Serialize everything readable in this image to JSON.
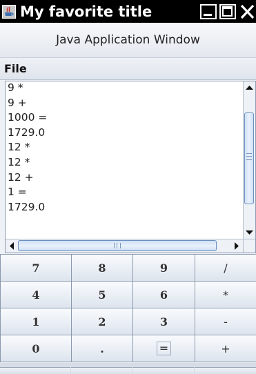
{
  "window": {
    "title": "My favorite title"
  },
  "header": {
    "label": "Java Application Window"
  },
  "menubar": {
    "items": [
      {
        "label": "File"
      }
    ]
  },
  "output": {
    "lines": [
      "9 *",
      "9 +",
      "1000 =",
      "1729.0",
      "12 *",
      "12 *",
      "12 +",
      "1 =",
      "1729.0"
    ]
  },
  "keypad": {
    "rows": [
      [
        "7",
        "8",
        "9",
        "/"
      ],
      [
        "4",
        "5",
        "6",
        "*"
      ],
      [
        "1",
        "2",
        "3",
        "-"
      ],
      [
        "0",
        ".",
        "=",
        "+"
      ]
    ]
  },
  "colors": {
    "titlebar": "#000000",
    "window_bg": "#eef1f6",
    "scroll_thumb_border": "#6d8fbf"
  }
}
